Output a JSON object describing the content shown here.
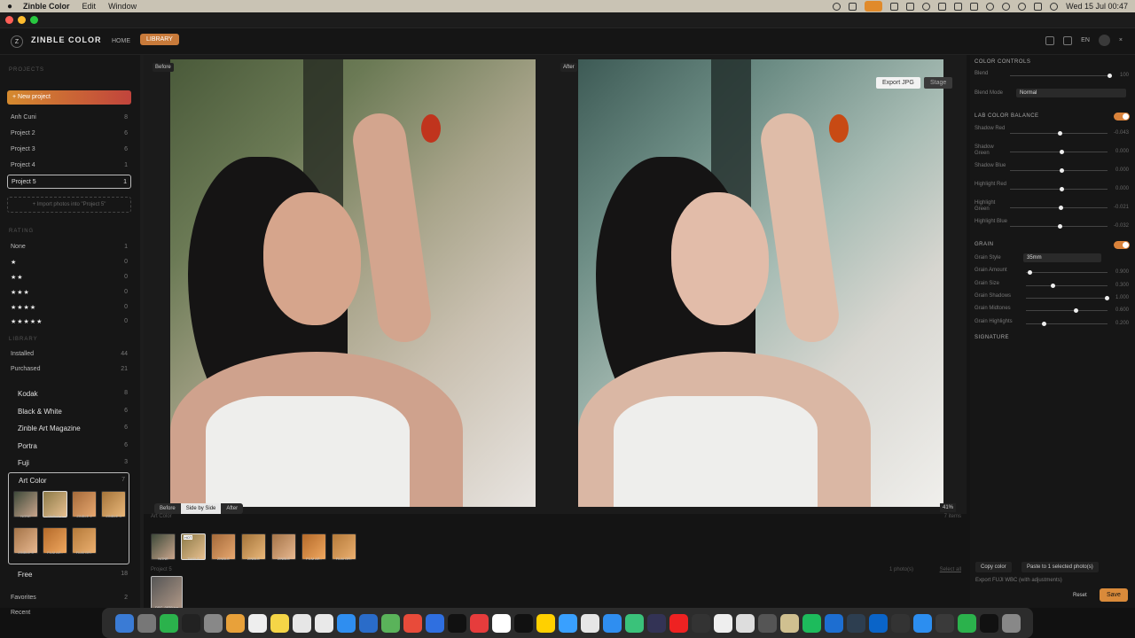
{
  "menubar": {
    "app": "Zinble Color",
    "items": [
      "Edit",
      "Window"
    ],
    "clock": "Wed 15 Jul  00:47"
  },
  "header": {
    "brand": "ZINBLE COLOR",
    "logo": "Z",
    "nav_home": "HOME",
    "nav_library": "LIBRARY",
    "lang": "EN"
  },
  "sidebar": {
    "projects_title": "PROJECTS",
    "new_project": "+ New project",
    "projects": [
      {
        "name": "Anh Cuni",
        "count": "8"
      },
      {
        "name": "Project 2",
        "count": "6"
      },
      {
        "name": "Project 3",
        "count": "6"
      },
      {
        "name": "Project 4",
        "count": "1"
      }
    ],
    "active_project": {
      "name": "Project 5",
      "count": "1"
    },
    "import": "+ Import photos into \"Project 5\"",
    "rating_title": "RATING",
    "ratings": [
      {
        "label": "None",
        "count": "1"
      },
      {
        "label": "★",
        "count": "0"
      },
      {
        "label": "★★",
        "count": "0"
      },
      {
        "label": "★★★",
        "count": "0"
      },
      {
        "label": "★★★★",
        "count": "0"
      },
      {
        "label": "★★★★★",
        "count": "0"
      }
    ],
    "library_title": "LIBRARY",
    "library": [
      {
        "name": "Installed",
        "count": "44"
      },
      {
        "name": "Purchased",
        "count": "21"
      }
    ],
    "collections": [
      {
        "name": "Kodak",
        "count": "8"
      },
      {
        "name": "Black & White",
        "count": "6"
      },
      {
        "name": "Zinble Art Magazine",
        "count": "6"
      },
      {
        "name": "Portra",
        "count": "6"
      },
      {
        "name": "Fuji",
        "count": "3"
      }
    ],
    "art_color": {
      "name": "Art Color",
      "count": "7",
      "thumbs": [
        "NONE",
        "ZINBLE 1",
        "ZINBLE 2",
        "ZINBLE 3",
        "ZINBLE 4",
        "FILM AR..",
        "FILM OR.."
      ]
    },
    "free": {
      "name": "Free",
      "count": "18"
    },
    "favorites": {
      "name": "Favorites",
      "count": "2"
    },
    "recent": {
      "name": "Recent",
      "count": "0"
    }
  },
  "canvas": {
    "before_label": "Before",
    "after_label": "After",
    "export": "Export JPG",
    "stage": "Stage",
    "views": [
      "Before",
      "Side by Side",
      "After"
    ],
    "active_view": "Side by Side",
    "zoom": "41%"
  },
  "filmstrip": {
    "title": "Art Color",
    "count": "7 items",
    "hot": "HOT",
    "thumbs": [
      "NONE",
      "ZINBLE",
      "ZINBLE",
      "ZINBLE",
      "ZINBLE",
      "FILM AR..",
      "FILM OR.."
    ],
    "project_title": "Project 5",
    "photos": "1 photo(s)",
    "select_all": "Select all",
    "project_thumb": "DSC_0839.jpg"
  },
  "rpanel": {
    "color_controls": "COLOR CONTROLS",
    "blend": {
      "label": "Blend",
      "value": "100",
      "pos": 1.0
    },
    "blend_mode": {
      "label": "Blend Mode",
      "value": "Normal"
    },
    "lab_title": "LAB COLOR BALANCE",
    "lab": [
      {
        "label": "Shadow Red",
        "value": "-0.043",
        "pos": 0.45
      },
      {
        "label": "Shadow Green",
        "value": "0.000",
        "pos": 0.5
      },
      {
        "label": "Shadow Blue",
        "value": "0.000",
        "pos": 0.5
      },
      {
        "label": "Highlight Red",
        "value": "0.000",
        "pos": 0.5
      },
      {
        "label": "Highlight Green",
        "value": "-0.021",
        "pos": 0.47
      },
      {
        "label": "Highlight Blue",
        "value": "-0.032",
        "pos": 0.47
      }
    ],
    "grain_title": "GRAIN",
    "grain_style": {
      "label": "Grain Style",
      "value": "35mm"
    },
    "grain": [
      {
        "label": "Grain Amount",
        "value": "0.900",
        "pos": 0.14
      },
      {
        "label": "Grain Size",
        "value": "0.300",
        "pos": 0.38
      },
      {
        "label": "Grain Shadows",
        "value": "1.000",
        "pos": 0.96
      },
      {
        "label": "Grain Midtones",
        "value": "0.600",
        "pos": 0.62
      },
      {
        "label": "Grain Highlights",
        "value": "0.200",
        "pos": 0.3
      }
    ],
    "signature": "SIGNATURE",
    "copy": "Copy color",
    "paste": "Paste to 1 selected photo(s)",
    "export_note": "Export FUJI WBC (with adjustments)",
    "reset": "Reset",
    "save": "Save"
  },
  "colors": {
    "accent": "#d9823a",
    "red_dot": "#ff5f57",
    "yellow_dot": "#febc2e",
    "green_dot": "#28c840"
  },
  "dock": {
    "icons": [
      "finder-icon",
      "settings-icon",
      "wechat-icon",
      "terminal-icon",
      "launchpad-icon",
      "photos-icon",
      "calendar-icon",
      "notes-icon",
      "slack-icon",
      "chrome-icon",
      "appstore-icon",
      "vscode-icon",
      "maps-icon",
      "app-icon",
      "finder2-icon",
      "tiktok-icon",
      "app2-icon",
      "opera-icon",
      "capcut-icon",
      "app3-icon",
      "app4-icon",
      "app5-icon",
      "safari-icon",
      "numbers-icon",
      "resolve-icon",
      "youtube-icon",
      "brush-icon",
      "chrome2-icon",
      "gear-icon",
      "app6-icon",
      "app7-icon",
      "app8-icon",
      "photoshop-icon",
      "app9-icon",
      "vscode2-icon",
      "app10-icon",
      "preview-icon",
      "quicktime-icon",
      "chrome3-icon",
      "zinble-icon",
      "trash-icon"
    ]
  }
}
